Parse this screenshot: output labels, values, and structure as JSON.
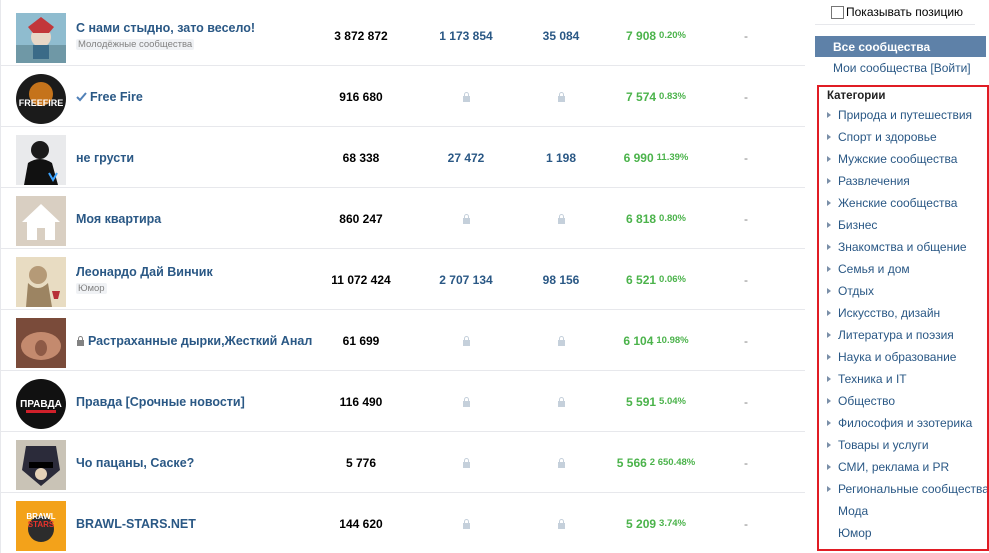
{
  "communities": [
    {
      "name": "С нами стыдно, зато весело!",
      "category": "Молодёжные сообщества",
      "members": "3 872 872",
      "reach": "1 173 854",
      "views": "35 084",
      "growth": "7 908",
      "growth_pct": "0.20%",
      "extra": "-",
      "verified": false,
      "closed": false
    },
    {
      "name": "Free Fire",
      "category": "",
      "members": "916 680",
      "reach": "",
      "views": "",
      "growth": "7 574",
      "growth_pct": "0.83%",
      "extra": "-",
      "verified": true,
      "closed": false
    },
    {
      "name": "не грусти",
      "category": "",
      "members": "68 338",
      "reach": "27 472",
      "views": "1 198",
      "growth": "6 990",
      "growth_pct": "11.39%",
      "extra": "-",
      "verified": false,
      "closed": false
    },
    {
      "name": "Моя квартира",
      "category": "",
      "members": "860 247",
      "reach": "",
      "views": "",
      "growth": "6 818",
      "growth_pct": "0.80%",
      "extra": "-",
      "verified": false,
      "closed": false
    },
    {
      "name": "Леонардо Дай Винчик",
      "category": "Юмор",
      "members": "11 072 424",
      "reach": "2 707 134",
      "views": "98 156",
      "growth": "6 521",
      "growth_pct": "0.06%",
      "extra": "-",
      "verified": false,
      "closed": false
    },
    {
      "name": "Растраханные дырки,Жесткий Анал",
      "category": "",
      "members": "61 699",
      "reach": "",
      "views": "",
      "growth": "6 104",
      "growth_pct": "10.98%",
      "extra": "-",
      "verified": false,
      "closed": true
    },
    {
      "name": "Правда [Срочные новости]",
      "category": "",
      "members": "116 490",
      "reach": "",
      "views": "",
      "growth": "5 591",
      "growth_pct": "5.04%",
      "extra": "-",
      "verified": false,
      "closed": false
    },
    {
      "name": "Чо пацаны, Саске?",
      "category": "",
      "members": "5 776",
      "reach": "",
      "views": "",
      "growth": "5 566",
      "growth_pct": "2 650.48%",
      "extra": "-",
      "verified": false,
      "closed": false
    },
    {
      "name": "BRAWL-STARS.NET",
      "category": "",
      "members": "144 620",
      "reach": "",
      "views": "",
      "growth": "5 209",
      "growth_pct": "3.74%",
      "extra": "-",
      "verified": false,
      "closed": false
    }
  ],
  "sidebar": {
    "show_position_label": "Показывать позицию",
    "all_communities": "Все сообщества",
    "my_communities": "Мои сообщества [Войти]",
    "categories_title": "Категории",
    "categories": [
      {
        "label": "Природа и путешествия",
        "expandable": true
      },
      {
        "label": "Спорт и здоровье",
        "expandable": true
      },
      {
        "label": "Мужские сообщества",
        "expandable": true
      },
      {
        "label": "Развлечения",
        "expandable": true
      },
      {
        "label": "Женские сообщества",
        "expandable": true
      },
      {
        "label": "Бизнес",
        "expandable": true
      },
      {
        "label": "Знакомства и общение",
        "expandable": true
      },
      {
        "label": "Семья и дом",
        "expandable": true
      },
      {
        "label": "Отдых",
        "expandable": true
      },
      {
        "label": "Искусство, дизайн",
        "expandable": true
      },
      {
        "label": "Литература и поэзия",
        "expandable": true
      },
      {
        "label": "Наука и образование",
        "expandable": true
      },
      {
        "label": "Техника и IT",
        "expandable": true
      },
      {
        "label": "Общество",
        "expandable": true
      },
      {
        "label": "Философия и эзотерика",
        "expandable": true
      },
      {
        "label": "Товары и услуги",
        "expandable": true
      },
      {
        "label": "СМИ, реклама и PR",
        "expandable": true
      },
      {
        "label": "Региональные сообщества",
        "expandable": true
      },
      {
        "label": "Мода",
        "expandable": false
      },
      {
        "label": "Юмор",
        "expandable": false
      }
    ]
  },
  "colors": {
    "link": "#2a5885",
    "growth": "#4bb34b",
    "active_nav": "#5e81a8",
    "highlight_border": "#e01c24"
  },
  "icons": [
    "lock-icon",
    "verified-check-icon",
    "expand-triangle-icon",
    "checkbox"
  ]
}
